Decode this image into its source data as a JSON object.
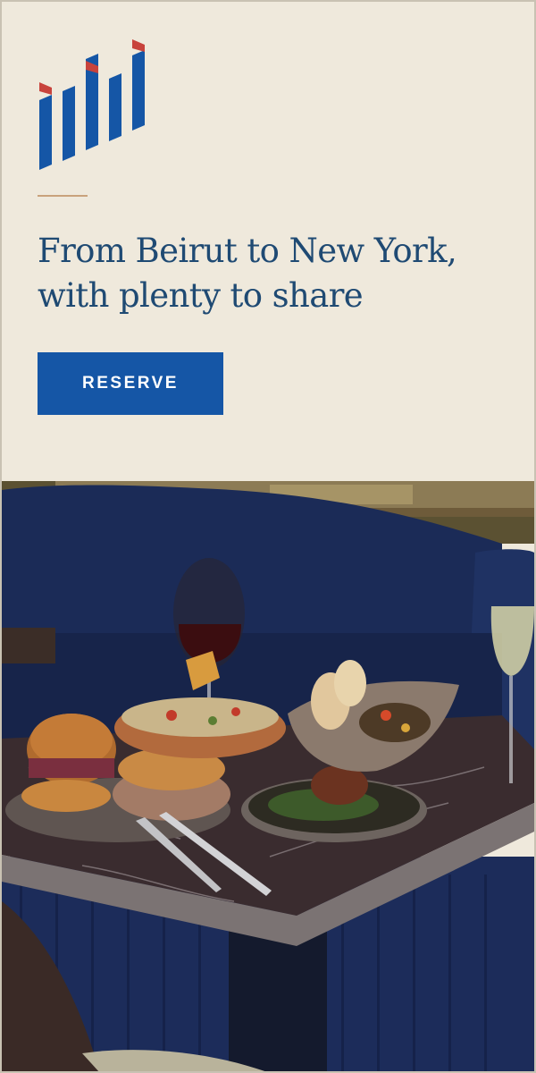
{
  "brand": {
    "name": "ilili",
    "colors": {
      "blue": "#1556a6",
      "red": "#c8433c",
      "cream": "#efe9dc",
      "headline": "#1f4a73",
      "divider": "#c9a27c"
    }
  },
  "hero": {
    "headline_line1": "From Beirut to New York,",
    "headline_line2": "with plenty to share"
  },
  "cta": {
    "label": "RESERVE"
  },
  "photo": {
    "icon": "food-table-photo"
  }
}
